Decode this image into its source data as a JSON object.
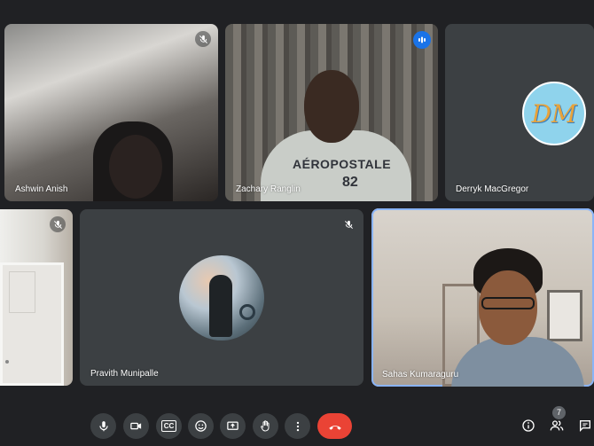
{
  "participants": [
    {
      "name": "Ashwin Anish",
      "muted": true
    },
    {
      "name": "Zachary Ranglin",
      "speaking": true,
      "shirt_text": "AÉROPOSTALE",
      "shirt_number": "82"
    },
    {
      "name": "Derryk MacGregor",
      "avatar_initials": "DM"
    },
    {
      "name": "",
      "muted": true
    },
    {
      "name": "Pravith Munipalle",
      "muted": true
    },
    {
      "name": "Sahas Kumaraguru",
      "active": true
    }
  ],
  "controls": {
    "buttons": [
      "mic-icon",
      "camera-icon",
      "captions-icon",
      "emoji-icon",
      "present-icon",
      "raise-hand-icon",
      "more-options-icon",
      "hangup-icon"
    ],
    "cc_label": "CC"
  },
  "right_controls": {
    "people_count": "7",
    "icons": [
      "info-icon",
      "people-icon",
      "chat-icon"
    ]
  },
  "colors": {
    "background": "#202124",
    "tile": "#3c4043",
    "hangup": "#ea4335",
    "accent": "#1a73e8",
    "active_border": "#8ab4f8"
  }
}
